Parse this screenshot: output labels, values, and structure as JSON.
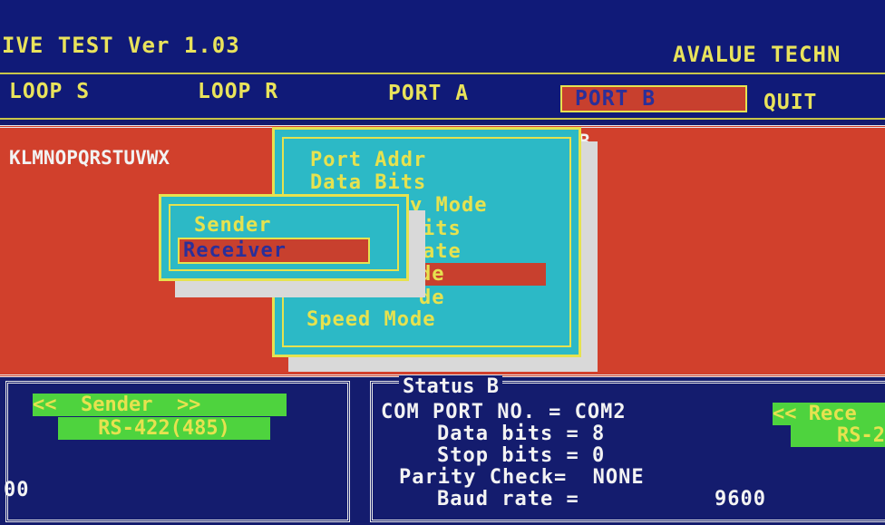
{
  "header": {
    "title": "IVE TEST Ver 1.03",
    "company": "AVALUE TECHN"
  },
  "menubar": {
    "items": [
      {
        "label": "LOOP S"
      },
      {
        "label": "LOOP R"
      },
      {
        "label": "PORT A"
      },
      {
        "label": "PORT B",
        "selected": true
      },
      {
        "label": "QUIT"
      }
    ]
  },
  "workspace": {
    "data_line": "KLMNOPQRSTUVWX",
    "port_marker": "B"
  },
  "port_menu": {
    "items": [
      "Port Addr",
      "Data Bits",
      "y Mode",
      "its",
      "ate",
      "de",
      "de",
      "Speed Mode"
    ],
    "selected_index": 5
  },
  "mode_submenu": {
    "items": [
      "Sender",
      "Receiver"
    ],
    "selected_index": 1
  },
  "left_panel": {
    "mode_label": "<<  Sender  >>",
    "interface": "RS-422(485)",
    "partial_value": "00"
  },
  "status": {
    "title": "Status B",
    "com_port_line": "COM PORT NO. = COM2",
    "data_bits_line": "Data bits = 8",
    "stop_bits_line": "Stop bits = 0",
    "parity_line": "Parity Check=  NONE",
    "baud_label": "Baud rate =",
    "baud_value": "9600",
    "right_mode_label": "<< Rece",
    "right_interface": "RS-2"
  },
  "colors": {
    "background_blue": "#141c6e",
    "panel_red": "#d1402c",
    "menu_cyan": "#2cb9c6",
    "text_yellow": "#e6e24f",
    "label_green": "#4ed33e"
  }
}
